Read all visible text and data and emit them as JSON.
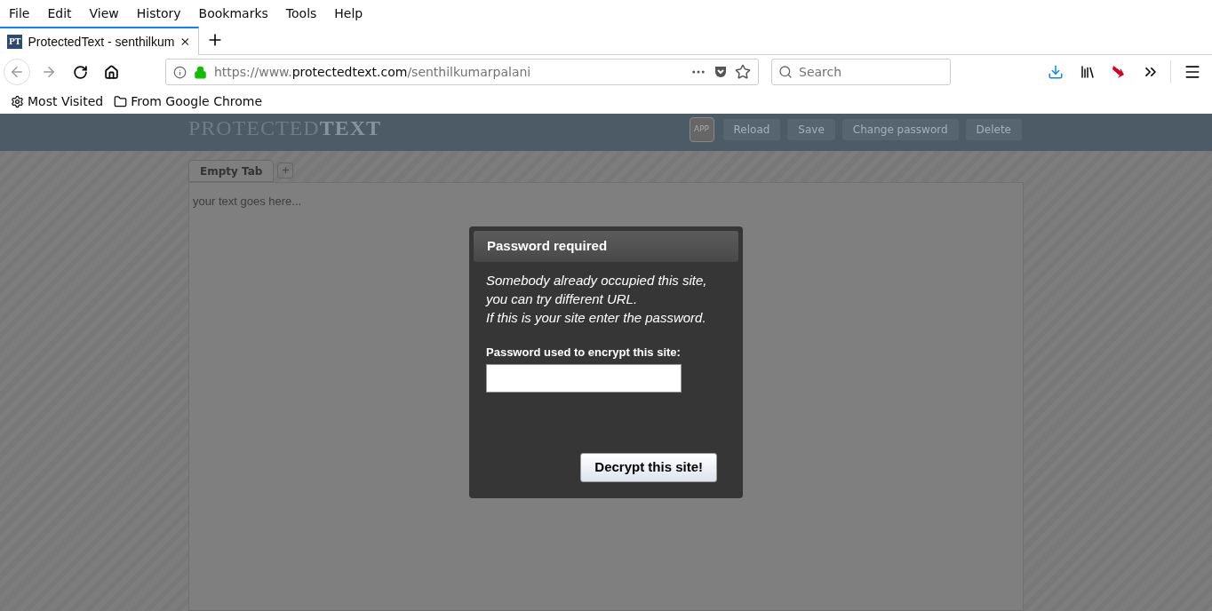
{
  "menu": [
    "File",
    "Edit",
    "View",
    "History",
    "Bookmarks",
    "Tools",
    "Help"
  ],
  "tabs": [
    {
      "favicon": "PT",
      "title": "ProtectedText - senthilkum",
      "selected": true
    }
  ],
  "address": {
    "prefix": "https://www.",
    "domain": "protectedtext.com",
    "path": "/senthilkumarpalani"
  },
  "search": {
    "placeholder": "Search"
  },
  "bookmarks": [
    {
      "kind": "gear",
      "label": "Most Visited"
    },
    {
      "kind": "folder",
      "label": "From Google Chrome"
    }
  ],
  "site": {
    "logo_light": "PROTECTED",
    "logo_bold": "TEXT",
    "app_badge": "APP",
    "buttons": [
      "Reload",
      "Save",
      "Change password",
      "Delete"
    ],
    "doc_tabs": [
      {
        "label": "Empty Tab",
        "selected": true
      }
    ],
    "add_tab": "+",
    "editor_placeholder": "your text goes here..."
  },
  "dialog": {
    "title": "Password required",
    "message": [
      "Somebody already occupied this site,",
      "you can try different URL.",
      "If this is your site enter the password."
    ],
    "field_label": "Password used to encrypt this site:",
    "button": "Decrypt this site!"
  }
}
